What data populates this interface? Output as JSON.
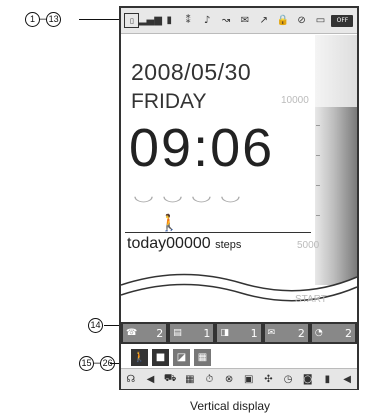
{
  "callouts": {
    "status_range": {
      "start": "1",
      "end": "13"
    },
    "tray": "14",
    "bottom_range": {
      "start": "15",
      "end": "26"
    }
  },
  "status_icons": [
    "sd-card-icon",
    "signal-icon",
    "battery-icon",
    "antenna-icon",
    "tone-icon",
    "pedometer-icon",
    "mail-icon",
    "call-forward-icon",
    "ssl",
    "no-infrared-icon",
    "pc-icon",
    "offline-icon"
  ],
  "clock": {
    "date": "2008/05/30",
    "weekday": "FRIDAY",
    "time": "09:06"
  },
  "pedometer": {
    "today_label": "today",
    "count": "00000",
    "unit": "steps",
    "scale_top": "10000",
    "scale_mid": "5000",
    "scale_bottom": "START"
  },
  "tray_items": [
    {
      "icon": "missed-call-icon",
      "count": "2"
    },
    {
      "icon": "message-icon",
      "count": "1"
    },
    {
      "icon": "voice-icon",
      "count": "1"
    },
    {
      "icon": "mail-icon",
      "count": "2"
    },
    {
      "icon": "schedule-icon",
      "count": "2"
    }
  ],
  "tray_sub_icons": [
    "walker-icon",
    "memo-icon",
    "reminder-icon",
    "document-icon"
  ],
  "bottom_icons": [
    "headset-icon",
    "speaker-icon",
    "car-icon",
    "calendar-icon",
    "stopwatch-icon",
    "no-vibe-icon",
    "tv-icon",
    "dial-icon",
    "clock-icon",
    "sd-icon",
    "recorder-icon",
    "mute-icon"
  ],
  "caption": "Vertical display",
  "colors": {
    "accent": "#333333",
    "meter_dark": "#7a7a7a"
  }
}
